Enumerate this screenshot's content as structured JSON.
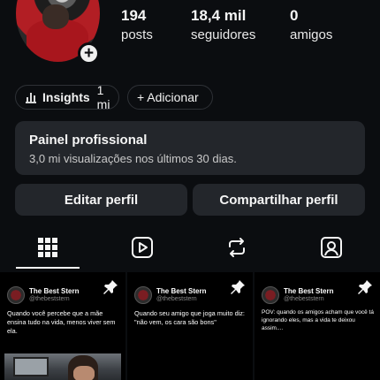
{
  "profile": {
    "stats": [
      {
        "value": "194",
        "label": "posts"
      },
      {
        "value": "18,4 mil",
        "label": "seguidores"
      },
      {
        "value": "0",
        "label": "amigos"
      }
    ],
    "add_badge": "+"
  },
  "chips": {
    "insights_label": "Insights",
    "insights_value": "1 mi",
    "add_label": "+ Adicionar"
  },
  "panel": {
    "title": "Painel profissional",
    "subtitle": "3,0 mi visualizações nos últimos 30 dias."
  },
  "buttons": {
    "edit": "Editar perfil",
    "share": "Compartilhar perfil"
  },
  "tabs": [
    "grid-icon",
    "reels-icon",
    "reposts-icon",
    "tagged-icon"
  ],
  "posts": [
    {
      "name": "The Best Stern",
      "handle": "@thebeststern",
      "text": "Quando você percebe que a mãe ensina tudo na vida, menos viver sem ela.",
      "pinned": true
    },
    {
      "name": "The Best Stern",
      "handle": "@thebeststern",
      "text": "Quando seu amigo que joga muito diz: \"não vem, os cara são bons\"",
      "pinned": true
    },
    {
      "name": "The Best Stern",
      "handle": "@thebeststern",
      "text": "POV: quando os amigos acham que você tá ignorando eles, mas a vida te deixou assim....",
      "pinned": true
    }
  ],
  "colors": {
    "background": "#0b0d10",
    "card": "#23262b",
    "text": "#f5f5f5"
  }
}
